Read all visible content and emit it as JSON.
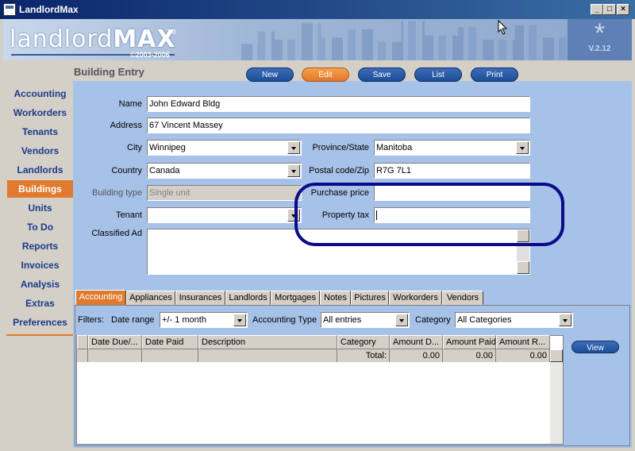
{
  "window": {
    "title": "LandlordMax"
  },
  "banner": {
    "logo_light": "landlord",
    "logo_bold": "MAX",
    "tm": "TM",
    "copyright": "©2003-2006",
    "version": "V.2.12"
  },
  "sidebar": {
    "items": [
      {
        "label": "Accounting"
      },
      {
        "label": "Workorders"
      },
      {
        "label": "Tenants"
      },
      {
        "label": "Vendors"
      },
      {
        "label": "Landlords"
      },
      {
        "label": "Buildings",
        "active": true
      },
      {
        "label": "Units"
      },
      {
        "label": "To Do"
      },
      {
        "label": "Reports"
      },
      {
        "label": "Invoices"
      },
      {
        "label": "Analysis"
      },
      {
        "label": "Extras"
      },
      {
        "label": "Preferences"
      }
    ]
  },
  "main": {
    "title": "Building Entry",
    "toolbar": {
      "new": "New",
      "edit": "Edit",
      "save": "Save",
      "list": "List",
      "print": "Print"
    }
  },
  "form": {
    "name_label": "Name",
    "name_value": "John Edward Bldg",
    "address_label": "Address",
    "address_value": "67 Vincent Massey",
    "city_label": "City",
    "city_value": "Winnipeg",
    "province_label": "Province/State",
    "province_value": "Manitoba",
    "country_label": "Country",
    "country_value": "Canada",
    "postal_label": "Postal code/Zip",
    "postal_value": "R7G 7L1",
    "building_type_label": "Building type",
    "building_type_value": "Single unit",
    "purchase_price_label": "Purchase price",
    "purchase_price_value": "",
    "tenant_label": "Tenant",
    "tenant_value": "",
    "property_tax_label": "Property tax",
    "property_tax_value": "",
    "classified_label": "Classified Ad",
    "classified_value": ""
  },
  "tabs": [
    {
      "label": "Accounting",
      "active": true
    },
    {
      "label": "Appliances"
    },
    {
      "label": "Insurances"
    },
    {
      "label": "Landlords"
    },
    {
      "label": "Mortgages"
    },
    {
      "label": "Notes"
    },
    {
      "label": "Pictures"
    },
    {
      "label": "Workorders"
    },
    {
      "label": "Vendors"
    }
  ],
  "filters": {
    "label": "Filters:",
    "date_range_label": "Date range",
    "date_range_value": "+/- 1 month",
    "acct_type_label": "Accounting Type",
    "acct_type_value": "All entries",
    "category_label": "Category",
    "category_value": "All Categories"
  },
  "table": {
    "columns": [
      "Date Due/...",
      "Date Paid",
      "Description",
      "Category",
      "Amount D...",
      "Amount Paid",
      "Amount R..."
    ],
    "totals": {
      "label": "Total:",
      "amount_due": "0.00",
      "amount_paid": "0.00",
      "amount_remaining": "0.00"
    }
  },
  "view_button": "View"
}
